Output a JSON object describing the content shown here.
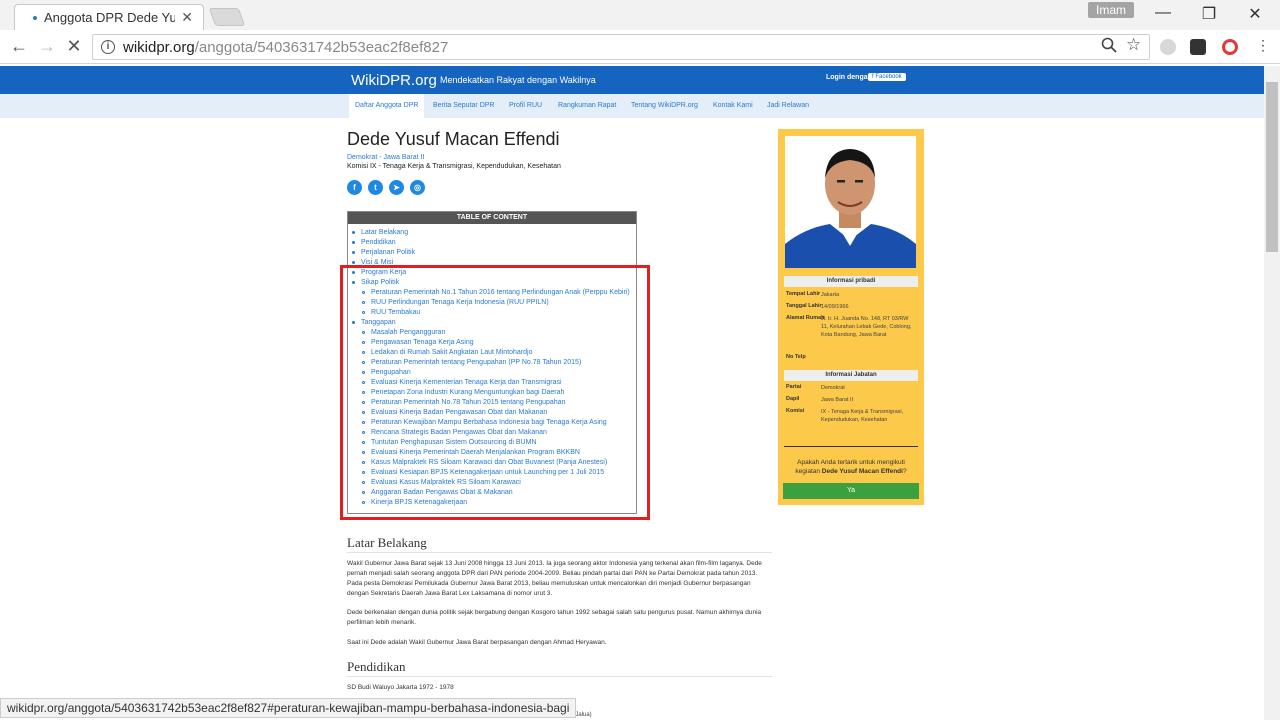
{
  "browser": {
    "tab_title": "Anggota DPR Dede Yusu",
    "user": "Imam",
    "url_host": "wikidpr.org",
    "url_path": "/anggota/5403631742b53eac2f8ef827",
    "status_url": "wikidpr.org/anggota/5403631742b53eac2f8ef827#peraturan-kewajiban-mampu-berbahasa-indonesia-bagi"
  },
  "site": {
    "brand": "WikiDPR.org",
    "tagline": "Mendekatkan Rakyat dengan Wakilnya",
    "login_label": "Login dengan",
    "facebook_label": "f Facebook",
    "nav": [
      "Daftar Anggota DPR",
      "Berita Seputar DPR",
      "Profil RUU",
      "Rangkuman Rapat",
      "Tentang WikiDPR.org",
      "Kontak Kami",
      "Jadi Relawan"
    ]
  },
  "profile": {
    "name": "Dede Yusuf Macan Effendi",
    "party_region": "Demokrat - Jawa Barat II",
    "komisi": "Komisi IX - Tenaga Kerja & Transmigrasi, Kependudukan, Kesehatan"
  },
  "toc": {
    "title": "TABLE OF CONTENT",
    "items": [
      {
        "text": "Latar Belakang",
        "sub": false
      },
      {
        "text": "Pendidikan",
        "sub": false
      },
      {
        "text": "Perjalanan Politik",
        "sub": false
      },
      {
        "text": "Visi & Misi",
        "sub": false
      },
      {
        "text": "Program Kerja",
        "sub": false
      },
      {
        "text": "Sikap Politik",
        "sub": false
      },
      {
        "text": "Peraturan Pemerintah No.1 Tahun 2016 tentang Perlindungan Anak (Perppu Kebiri)",
        "sub": true
      },
      {
        "text": "RUU Perlindungan Tenaga Kerja Indonesia (RUU PPILN)",
        "sub": true
      },
      {
        "text": "RUU Tembakau",
        "sub": true
      },
      {
        "text": "Tanggapan",
        "sub": false
      },
      {
        "text": "Masalah Pengangguran",
        "sub": true
      },
      {
        "text": "Pengawasan Tenaga Kerja Asing",
        "sub": true
      },
      {
        "text": "Ledakan di Rumah Sakit Angkatan Laut Mintohardjo",
        "sub": true
      },
      {
        "text": "Peraturan Pemerintah tentang Pengupahan (PP No.78 Tahun 2015)",
        "sub": true
      },
      {
        "text": "Pengupahan",
        "sub": true
      },
      {
        "text": "Evaluasi Kinerja Kementerian Tenaga Kerja dan Transmigrasi",
        "sub": true
      },
      {
        "text": "Penetapan Zona Industri Kurang Menguntungkan bagi Daerah",
        "sub": true
      },
      {
        "text": "Peraturan Pemerintah No.78 Tahun 2015 tentang Pengupahan",
        "sub": true
      },
      {
        "text": "Evaluasi Kinerja Badan Pengawasan Obat dan Makanan",
        "sub": true
      },
      {
        "text": "Peraturan Kewajiban Mampu Berbahasa Indonesia bagi Tenaga Kerja Asing",
        "sub": true
      },
      {
        "text": "Rencana Strategis Badan Pengawas Obat dan Makanan",
        "sub": true
      },
      {
        "text": "Tuntutan Penghapusan Sistem Outsourcing di BUMN",
        "sub": true
      },
      {
        "text": "Evaluasi Kinerja Pemerintah Daerah Menjalankan Program BKKBN",
        "sub": true
      },
      {
        "text": "Kasus Malpraktek RS Siloam Karawaci dan Obat Buvanest (Panja Anestesi)",
        "sub": true
      },
      {
        "text": "Evaluasi Kesiapan BPJS Ketenagakerjaan untuk Launching per 1 Juli 2015",
        "sub": true
      },
      {
        "text": "Evaluasi Kasus Malpraktek RS Siloam Karawaci",
        "sub": true
      },
      {
        "text": "Anggaran Badan Pengawas Obat & Makanan",
        "sub": true
      },
      {
        "text": "Kinerja BPJS Ketenagakerjaan",
        "sub": true
      }
    ]
  },
  "latar": {
    "title": "Latar Belakang",
    "p1": "Wakil Gubernur Jawa Barat sejak 13 Juni 2008 hingga 13 Juni 2013. Ia juga seorang aktor Indonesia yang terkenal akan film-film laganya. Dede pernah menjadi salah seorang anggota DPR dari PAN periode 2004-2009. Beliau pindah partai dari PAN ke Partai Demokrat pada tahun 2013. Pada pesta Demokrasi Pemilukada Gubernur Jawa Barat 2013, beliau memutuskan untuk mencalonkan diri menjadi Gubernur berpasangan dengan Sekretaris Daerah Jawa Barat Lex Laksamana di nomor urut 3.",
    "p2": "Dede berkenalan dengan dunia politik sejak bergabung dengan Kosgoro tahun 1992 sebagai salah satu pengurus pusat. Namun akhirnya dunia perfilman lebih menarik.",
    "p3": "Saat ini Dede adalah Wakil Gubernur Jawa Barat berpasangan dengan Ahmad Heryawan."
  },
  "pendidikan": {
    "title": "Pendidikan",
    "line1": "SD Budi Waluyo Jakarta 1972 - 1978",
    "peek": "lak Jalua)"
  },
  "sidebar": {
    "pribadi_head": "Informasi pribadi",
    "tempat_lahir_k": "Tempat Lahir",
    "tempat_lahir_v": "Jakarta",
    "tanggal_lahir_k": "Tanggal Lahir",
    "tanggal_lahir_v": "14/09/1966",
    "alamat_k": "Alamat Rumah",
    "alamat_v": "Jl. Ir. H. Juanda No. 148, RT 03/RW 11, Kelurahan Lebak Gede, Coblong, Kota Bandung, Jawa Barat",
    "telp_k": "No Telp",
    "jabatan_head": "Informasi Jabatan",
    "partai_k": "Partai",
    "partai_v": "Demokrat",
    "dapil_k": "Dapil",
    "dapil_v": "Jawa Barat II",
    "komisi_k": "Komisi",
    "komisi_v": "IX - Tenaga Kerja & Transmigrasi, Kependudukan, Kesehatan",
    "prompt_pre": "Apakah Anda tertarik untuk mengikuti kegiatan ",
    "prompt_name": "Dede Yusuf Macan Effendi",
    "prompt_post": "?",
    "ya_label": "Ya"
  }
}
